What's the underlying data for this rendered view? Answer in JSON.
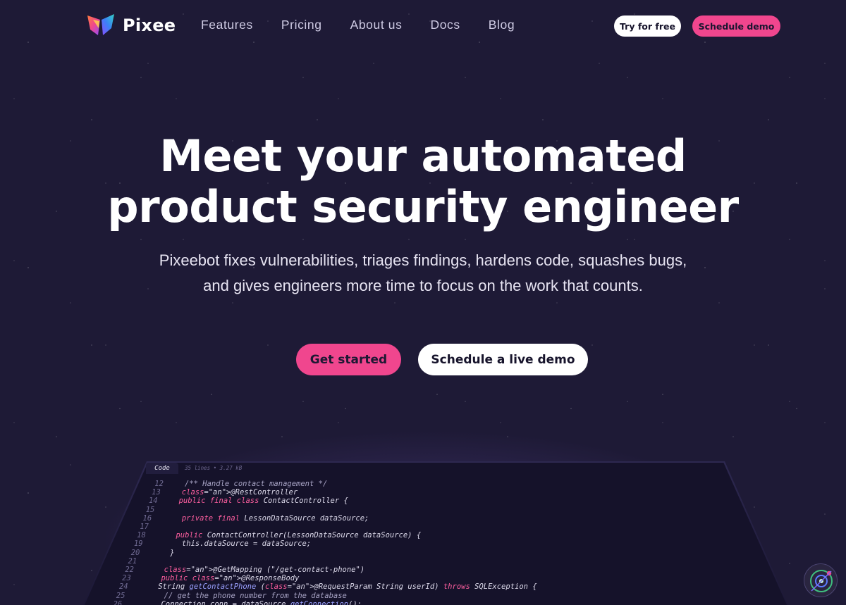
{
  "brand": {
    "name": "Pixee",
    "logo_icon": "butterfly-logo-icon"
  },
  "nav": {
    "links": [
      "Features",
      "Pricing",
      "About us",
      "Docs",
      "Blog"
    ],
    "try_label": "Try for free",
    "schedule_label": "Schedule demo"
  },
  "hero": {
    "title_line1": "Meet your automated",
    "title_line2": "product security engineer",
    "sub_line1": "Pixeebot fixes vulnerabilities, triages findings, hardens code, squashes bugs,",
    "sub_line2": "and gives engineers more time to focus on the work that counts.",
    "get_started_label": "Get started",
    "live_demo_label": "Schedule a live demo"
  },
  "code_panel": {
    "tab_label": "Code",
    "meta": "35 lines • 3.27 kB",
    "lines": [
      {
        "num": "12",
        "text": "/** Handle contact management */"
      },
      {
        "num": "13",
        "text": "@RestController"
      },
      {
        "num": "14",
        "text": "public final class ContactController {"
      },
      {
        "num": "15",
        "text": ""
      },
      {
        "num": "16",
        "text": "  private final LessonDataSource dataSource;"
      },
      {
        "num": "17",
        "text": ""
      },
      {
        "num": "18",
        "text": "  public ContactController(LessonDataSource dataSource) {"
      },
      {
        "num": "19",
        "text": "    this.dataSource = dataSource;"
      },
      {
        "num": "20",
        "text": "  }"
      },
      {
        "num": "21",
        "text": ""
      },
      {
        "num": "22",
        "text": "  @GetMapping (\"/get-contact-phone\")"
      },
      {
        "num": "23",
        "text": "  public @ResponseBody"
      },
      {
        "num": "24",
        "text": "  String getContactPhone (@RequestParam String userId) throws SQLException {"
      },
      {
        "num": "25",
        "text": "    // get the phone number from the database"
      },
      {
        "num": "26",
        "text": "    Connection conn = dataSource.getConnection();"
      }
    ]
  },
  "colors": {
    "background": "#1e1a36",
    "accent_pink": "#f0468e",
    "button_white": "#ffffff",
    "nav_text": "#cfcbe4"
  },
  "widget": {
    "icon": "chat-support-icon"
  }
}
